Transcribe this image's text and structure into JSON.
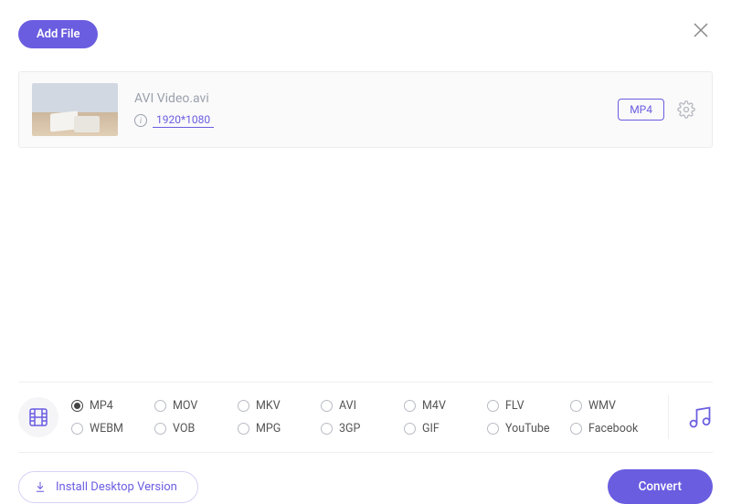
{
  "toolbar": {
    "add_file_label": "Add File"
  },
  "file": {
    "name": "AVI Video.avi",
    "resolution": "1920*1080",
    "output_format": "MP4"
  },
  "formats": {
    "options": [
      {
        "label": "MP4",
        "selected": true
      },
      {
        "label": "MOV",
        "selected": false
      },
      {
        "label": "MKV",
        "selected": false
      },
      {
        "label": "AVI",
        "selected": false
      },
      {
        "label": "M4V",
        "selected": false
      },
      {
        "label": "FLV",
        "selected": false
      },
      {
        "label": "WMV",
        "selected": false
      },
      {
        "label": "WEBM",
        "selected": false
      },
      {
        "label": "VOB",
        "selected": false
      },
      {
        "label": "MPG",
        "selected": false
      },
      {
        "label": "3GP",
        "selected": false
      },
      {
        "label": "GIF",
        "selected": false
      },
      {
        "label": "YouTube",
        "selected": false
      },
      {
        "label": "Facebook",
        "selected": false
      }
    ]
  },
  "footer": {
    "install_label": "Install Desktop Version",
    "convert_label": "Convert"
  },
  "colors": {
    "accent": "#6a5de0"
  }
}
